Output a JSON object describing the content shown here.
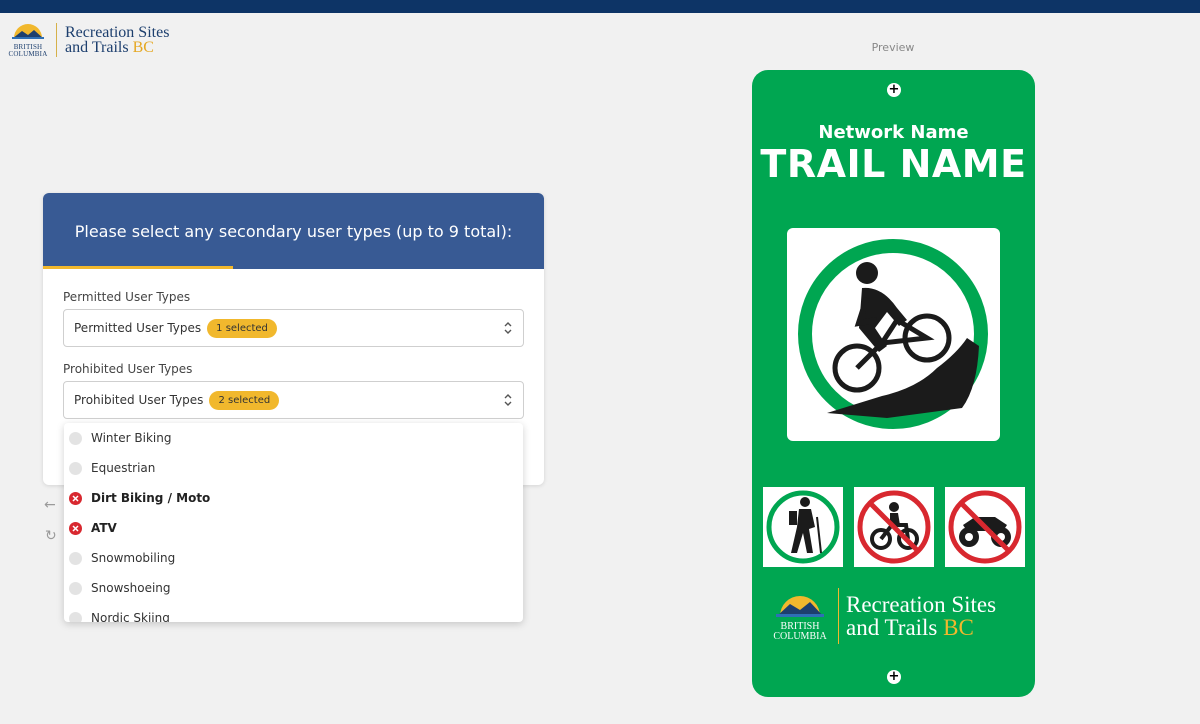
{
  "brand": {
    "province_line1": "BRITISH",
    "province_line2": "COLUMBIA",
    "name_line1": "Recreation Sites",
    "name_line2": "and Trails",
    "name_bc": "BC"
  },
  "card": {
    "heading": "Please select any secondary user types (up to 9 total):",
    "progress_fraction": 0.38,
    "permitted": {
      "label": "Permitted User Types",
      "value": "Permitted User Types",
      "badge": "1 selected"
    },
    "prohibited": {
      "label": "Prohibited User Types",
      "value": "Prohibited User Types",
      "badge": "2 selected"
    }
  },
  "dropdown": {
    "options": [
      {
        "label": "Winter Biking",
        "selected": false
      },
      {
        "label": "Equestrian",
        "selected": false
      },
      {
        "label": "Dirt Biking / Moto",
        "selected": true
      },
      {
        "label": "ATV",
        "selected": true
      },
      {
        "label": "Snowmobiling",
        "selected": false
      },
      {
        "label": "Snowshoeing",
        "selected": false
      },
      {
        "label": "Nordic Skiing",
        "selected": false
      }
    ]
  },
  "preview": {
    "label": "Preview",
    "network_name": "Network Name",
    "trail_name": "TRAIL NAME",
    "main_icon": "mountain-biking-icon",
    "permitted_icons": [
      "hiking-icon"
    ],
    "prohibited_icons": [
      "dirt-biking-icon",
      "atv-icon"
    ]
  },
  "colors": {
    "topbar": "#0d3466",
    "card_header": "#385a94",
    "accent": "#f1b82d",
    "sign_green": "#00a651",
    "prohibited_red": "#d8282f"
  }
}
